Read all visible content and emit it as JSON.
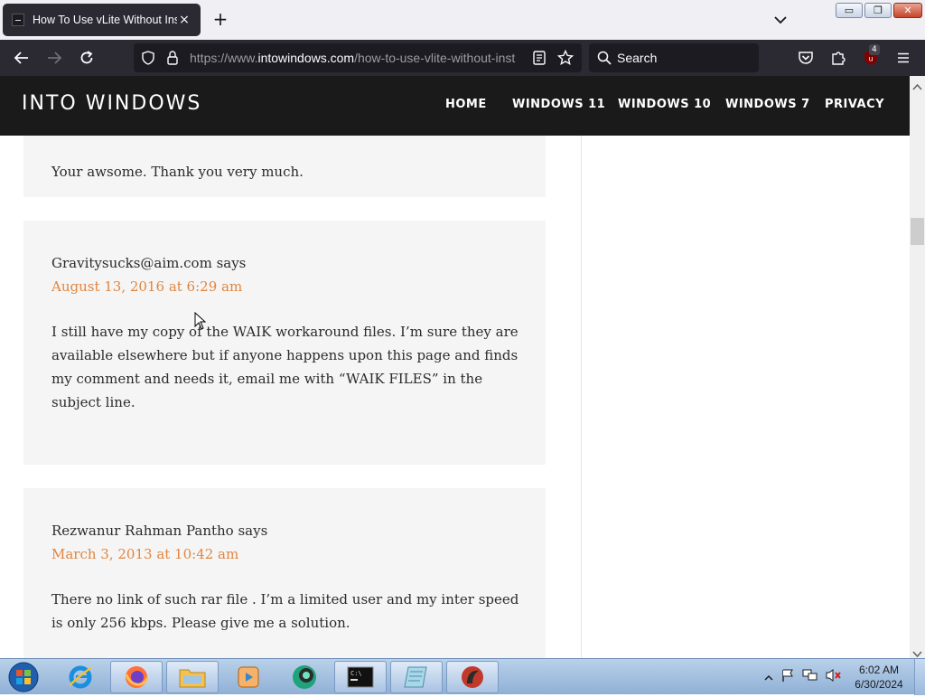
{
  "browser": {
    "tab": {
      "title": "How To Use vLite Without Insta",
      "close": "×"
    },
    "new_tab": "+",
    "url": {
      "prefix": "https://www.",
      "domain": "intowindows.com",
      "path": "/how-to-use-vlite-without-inst"
    },
    "search_placeholder": "Search",
    "extension_badge": "4",
    "window_controls": {
      "minimize": "▭",
      "restore": "❐",
      "close": "✕"
    }
  },
  "site": {
    "title": "INTO WINDOWS",
    "nav": [
      "HOME",
      "WINDOWS 11",
      "WINDOWS 10",
      "WINDOWS 7",
      "PRIVACY"
    ]
  },
  "comments": [
    {
      "body": "Your awsome. Thank you very much."
    },
    {
      "author": "Gravitysucks@aim.com says",
      "date": "August 13, 2016 at 6:29 am",
      "body": "I still have my copy of the WAIK workaround files. I’m sure they are available elsewhere but if anyone happens upon this page and finds my comment and needs it, email me with “WAIK FILES” in the subject line."
    },
    {
      "author": "Rezwanur Rahman Pantho says",
      "date": "March 3, 2013 at 10:42 am",
      "body": "There no link of such rar file . I’m a limited user and my inter speed is only 256 kbps. Please give me a solution."
    }
  ],
  "taskbar": {
    "time": "6:02 AM",
    "date": "6/30/2024",
    "items": [
      "internet-explorer",
      "firefox",
      "explorer",
      "media-player",
      "app-green",
      "command-prompt",
      "notepad",
      "app-red"
    ]
  },
  "colors": {
    "accent_date": "#e1853f",
    "header_bg": "#1a1a1a",
    "browser_dark": "#2b2a33"
  }
}
